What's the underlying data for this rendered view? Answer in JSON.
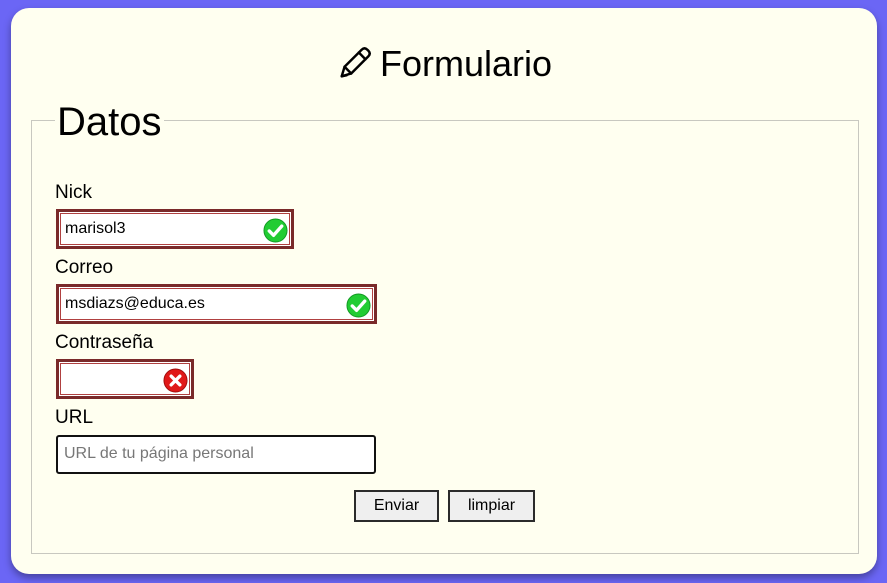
{
  "header": {
    "title": "Formulario",
    "icon": "pencil-icon"
  },
  "form": {
    "legend": "Datos",
    "fields": {
      "nick": {
        "label": "Nick",
        "value": "marisol3",
        "status": "valid"
      },
      "correo": {
        "label": "Correo",
        "value": "msdiazs@educa.es",
        "status": "valid"
      },
      "contrasena": {
        "label": "Contraseña",
        "value": "",
        "status": "invalid"
      },
      "url": {
        "label": "URL",
        "value": "",
        "placeholder": "URL de tu página personal"
      }
    },
    "buttons": {
      "submit": "Enviar",
      "reset": "limpiar"
    }
  },
  "colors": {
    "background": "#6b66f5",
    "card": "#fffff0",
    "invalid_border": "#7a2a2a",
    "valid_icon": "#22cc33",
    "invalid_icon": "#e01818"
  }
}
